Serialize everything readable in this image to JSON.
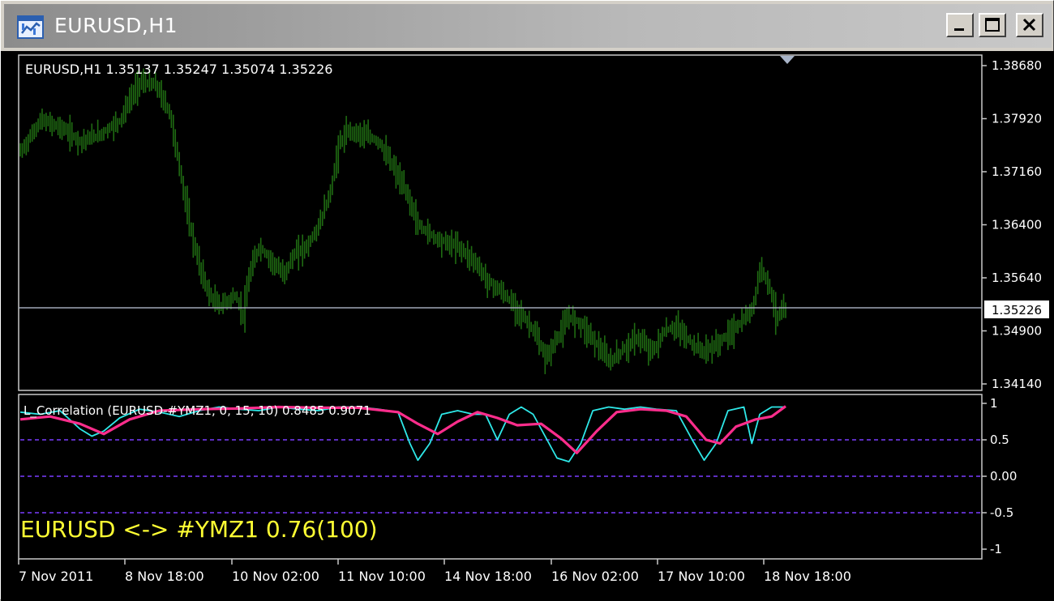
{
  "window": {
    "title": "EURUSD,H1",
    "icons": [
      "chart-window-icon",
      "minimize-icon",
      "maximize-icon",
      "close-icon"
    ]
  },
  "price_chart": {
    "info_label": "EURUSD,H1  1.35137 1.35247 1.35074 1.35226",
    "current_price_label": "1.35226",
    "price_axis_labels": [
      "1.38680",
      "1.37920",
      "1.37160",
      "1.36400",
      "1.35640",
      "1.34900",
      "1.34140"
    ]
  },
  "indicator": {
    "label": "L_Correlation (EURUSD-#YMZ1, 0, 15, 10) 0.8485 0.9071",
    "overlay_text": "EURUSD <-> #YMZ1   0.76(100)",
    "axis_labels": [
      "1",
      "0.5",
      "0.00",
      "-0.5",
      "-1"
    ]
  },
  "time_axis": {
    "labels": [
      "7 Nov 2011",
      "8 Nov 18:00",
      "10 Nov 02:00",
      "11 Nov 10:00",
      "14 Nov 18:00",
      "16 Nov 02:00",
      "17 Nov 10:00",
      "18 Nov 18:00"
    ]
  },
  "colors": {
    "background": "#000000",
    "bars": "#1f6b12",
    "price_line": "#a0a8b8",
    "correlation_fast": "#2ee8e8",
    "correlation_slow": "#ff2d8c",
    "levels": "#7a3cff",
    "overlay_text": "#ffff33",
    "axis_text": "#ffffff"
  },
  "chart_data": {
    "type": "bar",
    "symbol": "EURUSD",
    "timeframe": "H1",
    "price_ylim": [
      1.3414,
      1.3868
    ],
    "last_ohlc": {
      "open": 1.35137,
      "high": 1.35247,
      "low": 1.35074,
      "close": 1.35226
    },
    "price_close_path": [
      [
        0,
        1.3745
      ],
      [
        10,
        1.379
      ],
      [
        20,
        1.378
      ],
      [
        30,
        1.376
      ],
      [
        40,
        1.377
      ],
      [
        50,
        1.379
      ],
      [
        55,
        1.382
      ],
      [
        60,
        1.3845
      ],
      [
        68,
        1.384
      ],
      [
        75,
        1.38
      ],
      [
        80,
        1.372
      ],
      [
        85,
        1.364
      ],
      [
        90,
        1.358
      ],
      [
        95,
        1.354
      ],
      [
        100,
        1.3525
      ],
      [
        108,
        1.354
      ],
      [
        112,
        1.351
      ],
      [
        115,
        1.357
      ],
      [
        120,
        1.361
      ],
      [
        126,
        1.359
      ],
      [
        132,
        1.357
      ],
      [
        138,
        1.36
      ],
      [
        144,
        1.361
      ],
      [
        150,
        1.364
      ],
      [
        156,
        1.369
      ],
      [
        160,
        1.3755
      ],
      [
        165,
        1.3775
      ],
      [
        172,
        1.377
      ],
      [
        180,
        1.376
      ],
      [
        188,
        1.372
      ],
      [
        195,
        1.368
      ],
      [
        200,
        1.364
      ],
      [
        210,
        1.362
      ],
      [
        220,
        1.361
      ],
      [
        228,
        1.359
      ],
      [
        235,
        1.356
      ],
      [
        242,
        1.3545
      ],
      [
        250,
        1.352
      ],
      [
        258,
        1.349
      ],
      [
        264,
        1.345
      ],
      [
        270,
        1.348
      ],
      [
        276,
        1.351
      ],
      [
        282,
        1.35
      ],
      [
        290,
        1.347
      ],
      [
        296,
        1.3445
      ],
      [
        302,
        1.346
      ],
      [
        310,
        1.348
      ],
      [
        318,
        1.346
      ],
      [
        324,
        1.349
      ],
      [
        330,
        1.3495
      ],
      [
        338,
        1.347
      ],
      [
        344,
        1.346
      ],
      [
        350,
        1.347
      ],
      [
        356,
        1.3485
      ],
      [
        362,
        1.35
      ],
      [
        368,
        1.352
      ],
      [
        372,
        1.358
      ],
      [
        376,
        1.356
      ],
      [
        380,
        1.351
      ],
      [
        385,
        1.352
      ]
    ],
    "indicator_ylim": [
      -1,
      1
    ],
    "levels": [
      0.5,
      0,
      -0.5
    ],
    "series": [
      {
        "name": "0.8485",
        "values": [
          [
            0,
            0.88
          ],
          [
            10,
            0.85
          ],
          [
            20,
            0.9
          ],
          [
            30,
            0.65
          ],
          [
            36,
            0.55
          ],
          [
            42,
            0.62
          ],
          [
            50,
            0.8
          ],
          [
            60,
            0.92
          ],
          [
            70,
            0.88
          ],
          [
            80,
            0.82
          ],
          [
            90,
            0.9
          ],
          [
            100,
            0.95
          ],
          [
            110,
            0.92
          ],
          [
            120,
            0.9
          ],
          [
            130,
            0.95
          ],
          [
            140,
            0.92
          ],
          [
            150,
            0.9
          ],
          [
            160,
            0.95
          ],
          [
            170,
            0.95
          ],
          [
            180,
            0.92
          ],
          [
            190,
            0.88
          ],
          [
            196,
            0.45
          ],
          [
            200,
            0.22
          ],
          [
            206,
            0.45
          ],
          [
            212,
            0.85
          ],
          [
            220,
            0.9
          ],
          [
            228,
            0.85
          ],
          [
            234,
            0.85
          ],
          [
            240,
            0.5
          ],
          [
            246,
            0.85
          ],
          [
            252,
            0.95
          ],
          [
            258,
            0.85
          ],
          [
            264,
            0.55
          ],
          [
            270,
            0.25
          ],
          [
            276,
            0.2
          ],
          [
            282,
            0.45
          ],
          [
            288,
            0.9
          ],
          [
            296,
            0.95
          ],
          [
            304,
            0.92
          ],
          [
            312,
            0.95
          ],
          [
            320,
            0.92
          ],
          [
            330,
            0.9
          ],
          [
            338,
            0.5
          ],
          [
            344,
            0.22
          ],
          [
            350,
            0.45
          ],
          [
            356,
            0.9
          ],
          [
            364,
            0.95
          ],
          [
            368,
            0.45
          ],
          [
            372,
            0.85
          ],
          [
            378,
            0.95
          ],
          [
            385,
            0.95
          ]
        ]
      },
      {
        "name": "0.9071",
        "values": [
          [
            0,
            0.78
          ],
          [
            15,
            0.82
          ],
          [
            30,
            0.72
          ],
          [
            42,
            0.58
          ],
          [
            55,
            0.78
          ],
          [
            70,
            0.9
          ],
          [
            90,
            0.92
          ],
          [
            110,
            0.93
          ],
          [
            130,
            0.95
          ],
          [
            150,
            0.94
          ],
          [
            170,
            0.94
          ],
          [
            190,
            0.88
          ],
          [
            200,
            0.72
          ],
          [
            210,
            0.58
          ],
          [
            220,
            0.75
          ],
          [
            230,
            0.88
          ],
          [
            240,
            0.8
          ],
          [
            250,
            0.7
          ],
          [
            262,
            0.72
          ],
          [
            272,
            0.52
          ],
          [
            280,
            0.32
          ],
          [
            290,
            0.62
          ],
          [
            300,
            0.88
          ],
          [
            312,
            0.92
          ],
          [
            325,
            0.9
          ],
          [
            335,
            0.82
          ],
          [
            345,
            0.5
          ],
          [
            352,
            0.45
          ],
          [
            360,
            0.68
          ],
          [
            370,
            0.78
          ],
          [
            378,
            0.82
          ],
          [
            385,
            0.96
          ]
        ]
      }
    ]
  }
}
